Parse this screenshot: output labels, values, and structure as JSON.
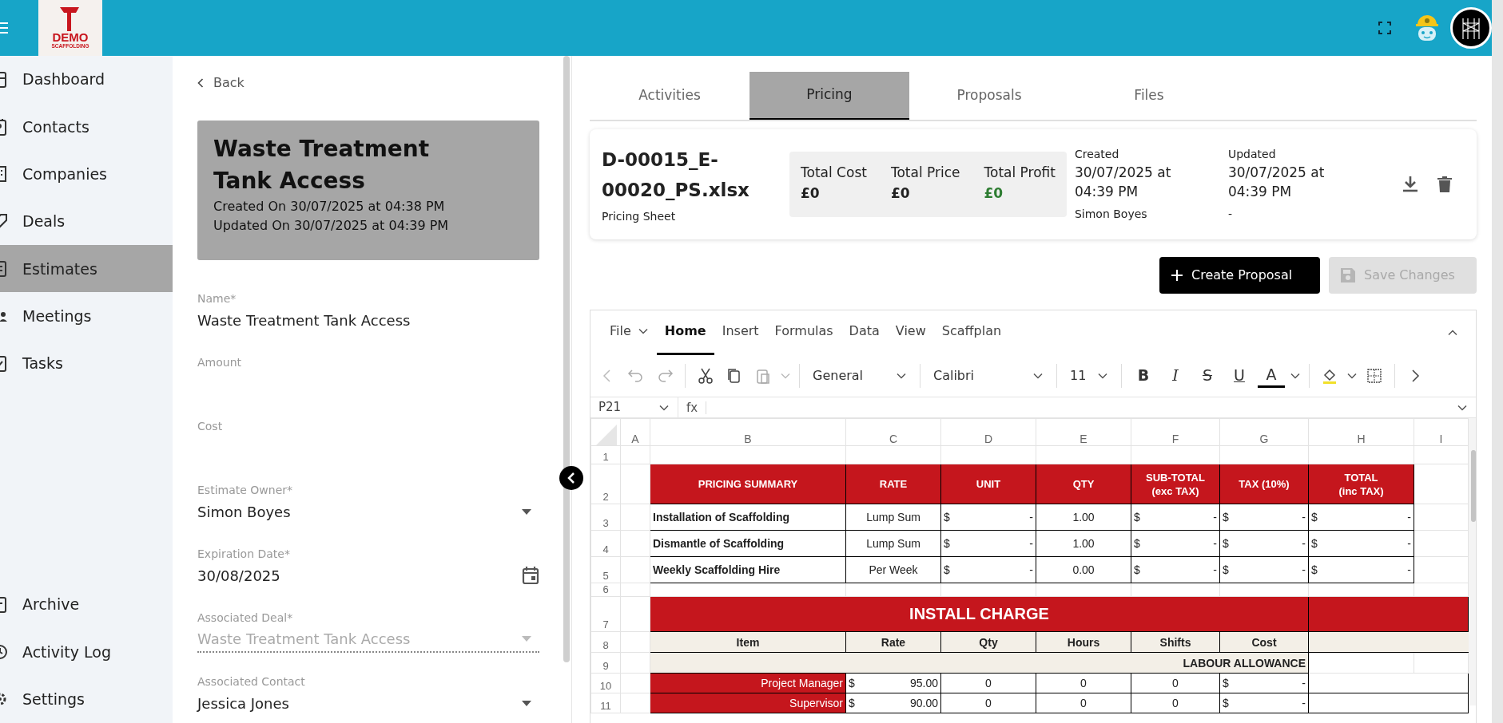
{
  "topbar": {
    "logo": {
      "title": "DEMO",
      "subtitle": "SCAFFOLDING"
    }
  },
  "sidebar": {
    "items": [
      {
        "label": "Dashboard",
        "selected": false
      },
      {
        "label": "Contacts",
        "selected": false
      },
      {
        "label": "Companies",
        "selected": false
      },
      {
        "label": "Deals",
        "selected": false
      },
      {
        "label": "Estimates",
        "selected": true
      },
      {
        "label": "Meetings",
        "selected": false
      },
      {
        "label": "Tasks",
        "selected": false
      }
    ],
    "bottom_items": [
      {
        "label": "Archive",
        "selected": false
      },
      {
        "label": "Activity Log",
        "selected": false
      },
      {
        "label": "Settings",
        "selected": false
      }
    ]
  },
  "back": "Back",
  "record": {
    "title": "Waste Treatment Tank Access",
    "created": "Created On 30/07/2025 at 04:38 PM",
    "updated": "Updated On 30/07/2025 at 04:39 PM"
  },
  "fields": [
    {
      "label": "Name*",
      "kind": "text",
      "value": "Waste Treatment Tank Access",
      "disabled": false
    },
    {
      "label": "Amount",
      "kind": "text",
      "disabled": false
    },
    {
      "label": "Cost",
      "kind": "text",
      "disabled": false
    },
    {
      "label": "Estimate Owner*",
      "kind": "select",
      "value": "Simon Boyes",
      "disabled": false
    },
    {
      "label": "Expiration Date*",
      "kind": "date",
      "value": "30/08/2025",
      "disabled": false
    },
    {
      "label": "Associated Deal*",
      "kind": "select",
      "value": "Waste Treatment Tank Access",
      "disabled": true
    },
    {
      "label": "Associated Contact",
      "kind": "select",
      "value": "Jessica Jones",
      "disabled": false
    }
  ],
  "tabs": [
    {
      "label": "Activities",
      "selected": false
    },
    {
      "label": "Pricing",
      "selected": true
    },
    {
      "label": "Proposals",
      "selected": false
    },
    {
      "label": "Files",
      "selected": false
    }
  ],
  "pricing_file": {
    "name": "D-00015_E-00020_PS.xlsx",
    "type": "Pricing Sheet",
    "totals": [
      {
        "label": "Total Cost",
        "value": "£0",
        "kind": "cost"
      },
      {
        "label": "Total Price",
        "value": "£0",
        "kind": "price"
      },
      {
        "label": "Total Profit",
        "value": "£0",
        "kind": "profit"
      }
    ],
    "meta": [
      {
        "label": "Created",
        "date": "30/07/2025 at 04:39 PM",
        "by": "Simon Boyes"
      },
      {
        "label": "Updated",
        "date": "30/07/2025 at 04:39 PM",
        "by": "-"
      }
    ]
  },
  "actions": [
    {
      "label": "Create Proposal",
      "kind": "create",
      "disabled": false
    },
    {
      "label": "Save Changes",
      "kind": "save",
      "disabled": true
    }
  ],
  "sheet": {
    "ribbon_tabs": [
      {
        "label": "File",
        "selected": false,
        "menu": true
      },
      {
        "label": "Home",
        "selected": true,
        "menu": false
      },
      {
        "label": "Insert",
        "selected": false,
        "menu": false
      },
      {
        "label": "Formulas",
        "selected": false,
        "menu": false
      },
      {
        "label": "Data",
        "selected": false,
        "menu": false
      },
      {
        "label": "View",
        "selected": false,
        "menu": false
      },
      {
        "label": "Scaffplan",
        "selected": false,
        "menu": false
      }
    ],
    "toolbar": {
      "number_format": "General",
      "font": "Calibri",
      "font_size": "11",
      "format_buttons": [
        "B",
        "I",
        "S",
        "U",
        "A"
      ]
    },
    "name_box": "P21",
    "formula_label": "fx",
    "columns": [
      "A",
      "B",
      "C",
      "D",
      "E",
      "F",
      "G",
      "H",
      "I"
    ],
    "rows": [
      {
        "number": "1",
        "kind": "blank"
      },
      {
        "number": "2",
        "kind": "summary_header",
        "cells": [
          "PRICING SUMMARY",
          "RATE",
          "UNIT",
          "QTY",
          "SUB-TOTAL\n(exc TAX)",
          "TAX (10%)",
          "TOTAL\n(inc TAX)"
        ]
      },
      {
        "number": "3",
        "kind": "summary_row",
        "cells": [
          {
            "text": "Installation of Scaffolding"
          },
          {
            "text": "Lump Sum"
          },
          {
            "symbol": "$",
            "text": "-"
          },
          {
            "text": "1.00"
          },
          {
            "symbol": "$",
            "text": "-"
          },
          {
            "symbol": "$",
            "text": "-"
          },
          {
            "symbol": "$",
            "text": "-"
          }
        ]
      },
      {
        "number": "4",
        "kind": "summary_row",
        "cells": [
          {
            "text": "Dismantle of Scaffolding"
          },
          {
            "text": "Lump Sum"
          },
          {
            "symbol": "$",
            "text": "-"
          },
          {
            "text": "1.00"
          },
          {
            "symbol": "$",
            "text": "-"
          },
          {
            "symbol": "$",
            "text": "-"
          },
          {
            "symbol": "$",
            "text": "-"
          }
        ]
      },
      {
        "number": "5",
        "kind": "summary_row",
        "cells": [
          {
            "text": "Weekly Scaffolding Hire"
          },
          {
            "text": "Per Week"
          },
          {
            "symbol": "$",
            "text": "-"
          },
          {
            "text": "0.00"
          },
          {
            "symbol": "$",
            "text": "-"
          },
          {
            "symbol": "$",
            "text": "-"
          },
          {
            "symbol": "$",
            "text": "-"
          }
        ]
      },
      {
        "number": "6",
        "kind": "blank"
      },
      {
        "number": "7",
        "kind": "banner",
        "cells": [
          "INSTALL CHARGE"
        ]
      },
      {
        "number": "8",
        "kind": "table_header",
        "cells": [
          "Item",
          "Rate",
          "Qty",
          "Hours",
          "Shifts",
          "Cost"
        ]
      },
      {
        "number": "9",
        "kind": "section",
        "cells": [
          "LABOUR ALLOWANCE"
        ]
      },
      {
        "number": "10",
        "kind": "labour_row",
        "cells": [
          {
            "text": "Project Manager"
          },
          {
            "symbol": "$",
            "text": "95.00"
          },
          {
            "text": "0"
          },
          {
            "text": "0"
          },
          {
            "text": "0"
          },
          {
            "symbol": "$",
            "text": "-"
          }
        ]
      },
      {
        "number": "11",
        "kind": "labour_row",
        "cells": [
          {
            "text": "Supervisor"
          },
          {
            "symbol": "$",
            "text": "90.00"
          },
          {
            "text": "0"
          },
          {
            "text": "0"
          },
          {
            "text": "0"
          },
          {
            "symbol": "$",
            "text": "-"
          }
        ]
      }
    ]
  }
}
